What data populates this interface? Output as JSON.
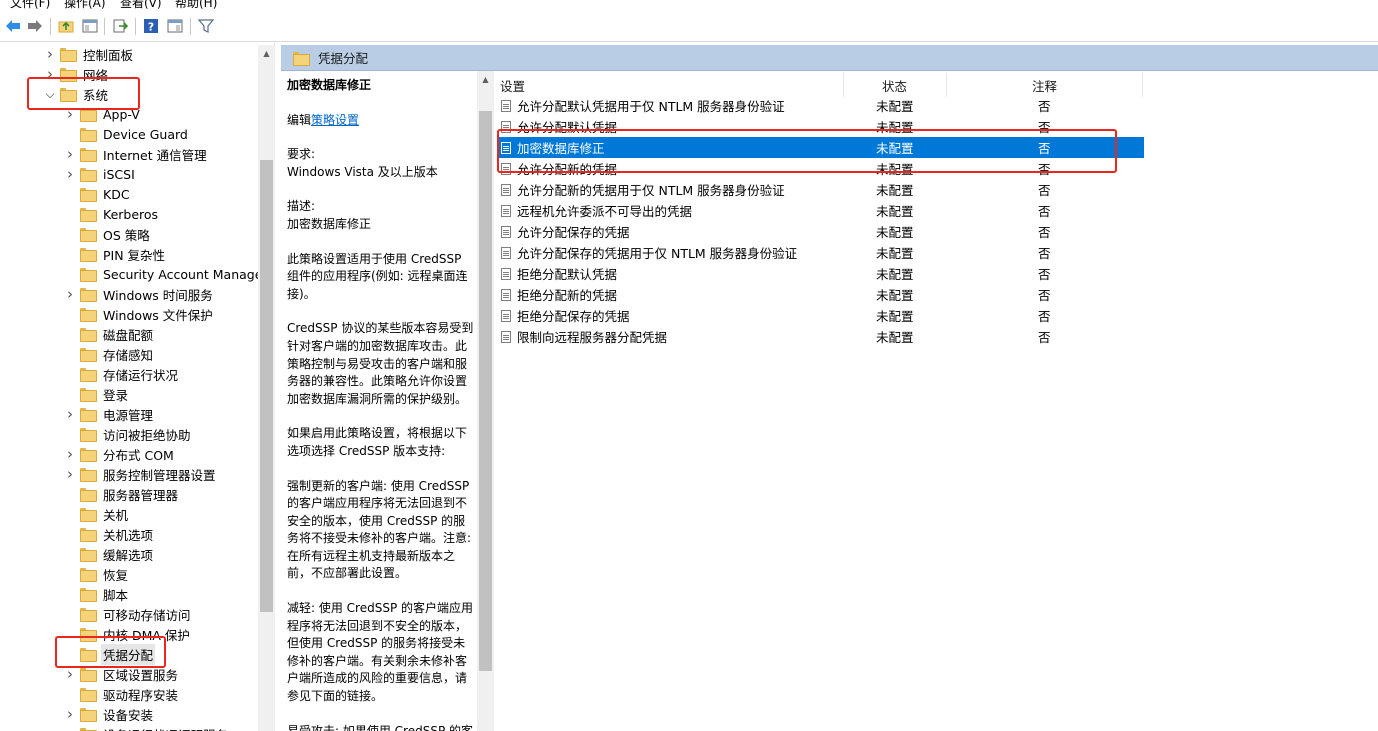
{
  "menu": [
    "文件(F)",
    "操作(A)",
    "查看(V)",
    "帮助(H)"
  ],
  "toolbar": {
    "back": "back-arrow-icon",
    "forward": "forward-arrow-icon",
    "up": "folder-up-icon",
    "show_tree": "console-tree-icon",
    "export": "export-list-icon",
    "help": "help-icon",
    "view": "view-icon",
    "filter": "filter-icon"
  },
  "tree": {
    "items": [
      {
        "label": "控制面板",
        "expandable": true
      },
      {
        "label": "网络",
        "expandable": true
      },
      {
        "label": "系统",
        "expanded": true
      },
      {
        "label": "App-V",
        "expandable": true
      },
      {
        "label": "Device Guard",
        "expandable": false
      },
      {
        "label": "Internet 通信管理",
        "expandable": true
      },
      {
        "label": "iSCSI",
        "expandable": true
      },
      {
        "label": "KDC",
        "expandable": false
      },
      {
        "label": "Kerberos",
        "expandable": false
      },
      {
        "label": "OS 策略",
        "expandable": false
      },
      {
        "label": "PIN 复杂性",
        "expandable": false
      },
      {
        "label": "Security Account Manager",
        "expandable": false
      },
      {
        "label": "Windows 时间服务",
        "expandable": true
      },
      {
        "label": "Windows 文件保护",
        "expandable": false
      },
      {
        "label": "磁盘配额",
        "expandable": false
      },
      {
        "label": "存储感知",
        "expandable": false
      },
      {
        "label": "存储运行状况",
        "expandable": false
      },
      {
        "label": "登录",
        "expandable": false
      },
      {
        "label": "电源管理",
        "expandable": true
      },
      {
        "label": "访问被拒绝协助",
        "expandable": false
      },
      {
        "label": "分布式 COM",
        "expandable": true
      },
      {
        "label": "服务控制管理器设置",
        "expandable": true
      },
      {
        "label": "服务器管理器",
        "expandable": false
      },
      {
        "label": "关机",
        "expandable": false
      },
      {
        "label": "关机选项",
        "expandable": false
      },
      {
        "label": "缓解选项",
        "expandable": false
      },
      {
        "label": "恢复",
        "expandable": false
      },
      {
        "label": "脚本",
        "expandable": false
      },
      {
        "label": "可移动存储访问",
        "expandable": false
      },
      {
        "label": "内核 DMA 保护",
        "expandable": false
      },
      {
        "label": "凭据分配",
        "selected": true
      },
      {
        "label": "区域设置服务",
        "expandable": true
      },
      {
        "label": "驱动程序安装",
        "expandable": false
      },
      {
        "label": "设备安装",
        "expandable": true
      },
      {
        "label": "设备运行状况证明服务",
        "expandable": false
      }
    ]
  },
  "header": {
    "title": "凭据分配"
  },
  "desc": {
    "title": "加密数据库修正",
    "edit_prefix": "编辑",
    "edit_link": "策略设置",
    "req_label": "要求:",
    "req_value": "Windows Vista 及以上版本",
    "desc_label": "描述:",
    "desc_value": "加密数据库修正",
    "p1": "此策略设置适用于使用 CredSSP 组件的应用程序(例如: 远程桌面连接)。",
    "p2": "CredSSP 协议的某些版本容易受到针对客户端的加密数据库攻击。此策略控制与易受攻击的客户端和服务器的兼容性。此策略允许你设置加密数据库漏洞所需的保护级别。",
    "p3": "如果启用此策略设置，将根据以下选项选择 CredSSP 版本支持:",
    "p4": "强制更新的客户端: 使用 CredSSP 的客户端应用程序将无法回退到不安全的版本，使用 CredSSP 的服务将不接受未修补的客户端。注意: 在所有远程主机支持最新版本之前，不应部署此设置。",
    "p5": "减轻: 使用 CredSSP 的客户端应用程序将无法回退到不安全的版本，但使用 CredSSP 的服务将接受未修补的客户端。有关剩余未修补客户端所造成的风险的重要信息，请参见下面的链接。",
    "p6": "易受攻击: 如果使用 CredSSP 的客户端应用程序可以回退到不安全的"
  },
  "list": {
    "columns": {
      "setting": "设置",
      "state": "状态",
      "note": "注释"
    },
    "rows": [
      {
        "name": "允许分配默认凭据用于仅 NTLM 服务器身份验证",
        "state": "未配置",
        "note": "否"
      },
      {
        "name": "允许分配默认凭据",
        "state": "未配置",
        "note": "否"
      },
      {
        "name": "加密数据库修正",
        "state": "未配置",
        "note": "否",
        "selected": true
      },
      {
        "name": "允许分配新的凭据",
        "state": "未配置",
        "note": "否"
      },
      {
        "name": "允许分配新的凭据用于仅 NTLM 服务器身份验证",
        "state": "未配置",
        "note": "否"
      },
      {
        "name": "远程机允许委派不可导出的凭据",
        "state": "未配置",
        "note": "否"
      },
      {
        "name": "允许分配保存的凭据",
        "state": "未配置",
        "note": "否"
      },
      {
        "name": "允许分配保存的凭据用于仅 NTLM 服务器身份验证",
        "state": "未配置",
        "note": "否"
      },
      {
        "name": "拒绝分配默认凭据",
        "state": "未配置",
        "note": "否"
      },
      {
        "name": "拒绝分配新的凭据",
        "state": "未配置",
        "note": "否"
      },
      {
        "name": "拒绝分配保存的凭据",
        "state": "未配置",
        "note": "否"
      },
      {
        "name": "限制向远程服务器分配凭据",
        "state": "未配置",
        "note": "否"
      }
    ]
  },
  "colors": {
    "selection": "#0078d7",
    "header_band": "#b9cde5",
    "annotation": "#e8281f"
  }
}
